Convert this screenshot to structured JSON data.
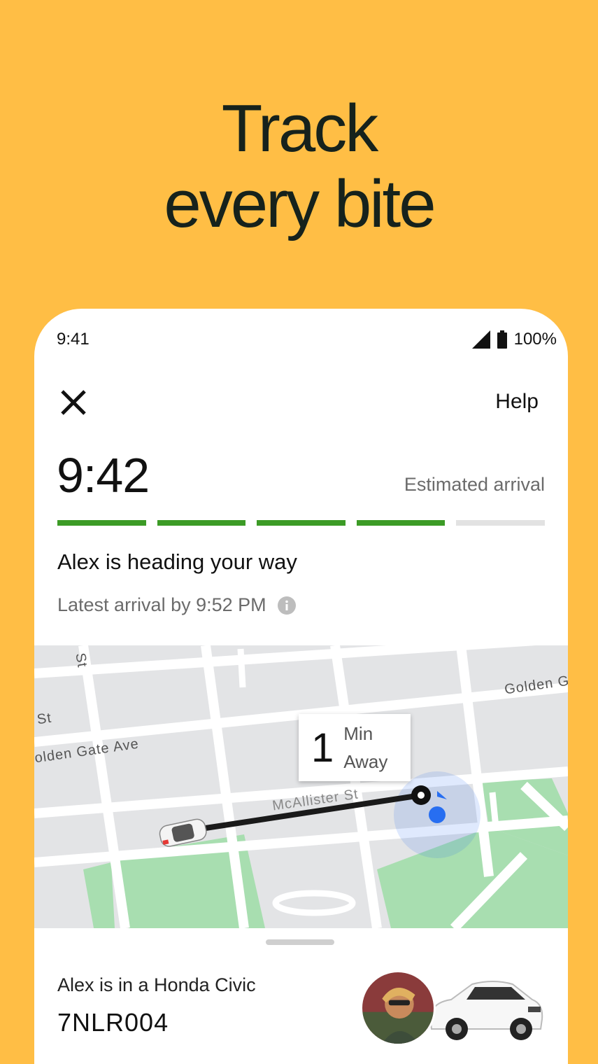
{
  "promo": {
    "headline_line1": "Track",
    "headline_line2": "every bite"
  },
  "status_bar": {
    "time": "9:41",
    "battery": "100%"
  },
  "top_bar": {
    "help_label": "Help"
  },
  "eta": {
    "time": "9:42",
    "label": "Estimated arrival",
    "progress_segments_total": 5,
    "progress_segments_done": 4
  },
  "trip": {
    "heading": "Alex is heading your way",
    "latest_arrival": "Latest arrival by 9:52 PM"
  },
  "map": {
    "eta_number": "1",
    "eta_unit_line1": "Min",
    "eta_unit_line2": "Away",
    "streets": {
      "golden_gate_ave": "olden Gate Ave",
      "mcallister": "McAllister St",
      "golden_top": "Golden G",
      "st_left": "St",
      "st_top": "St"
    }
  },
  "driver": {
    "vehicle": "Alex is in a Honda Civic",
    "plate": "7NLR004"
  },
  "colors": {
    "background": "#FFBE45",
    "progress_done": "#3c9b26",
    "progress_todo": "#e2e2e2",
    "park": "#a8deb0",
    "location_blue": "#276ef1"
  }
}
